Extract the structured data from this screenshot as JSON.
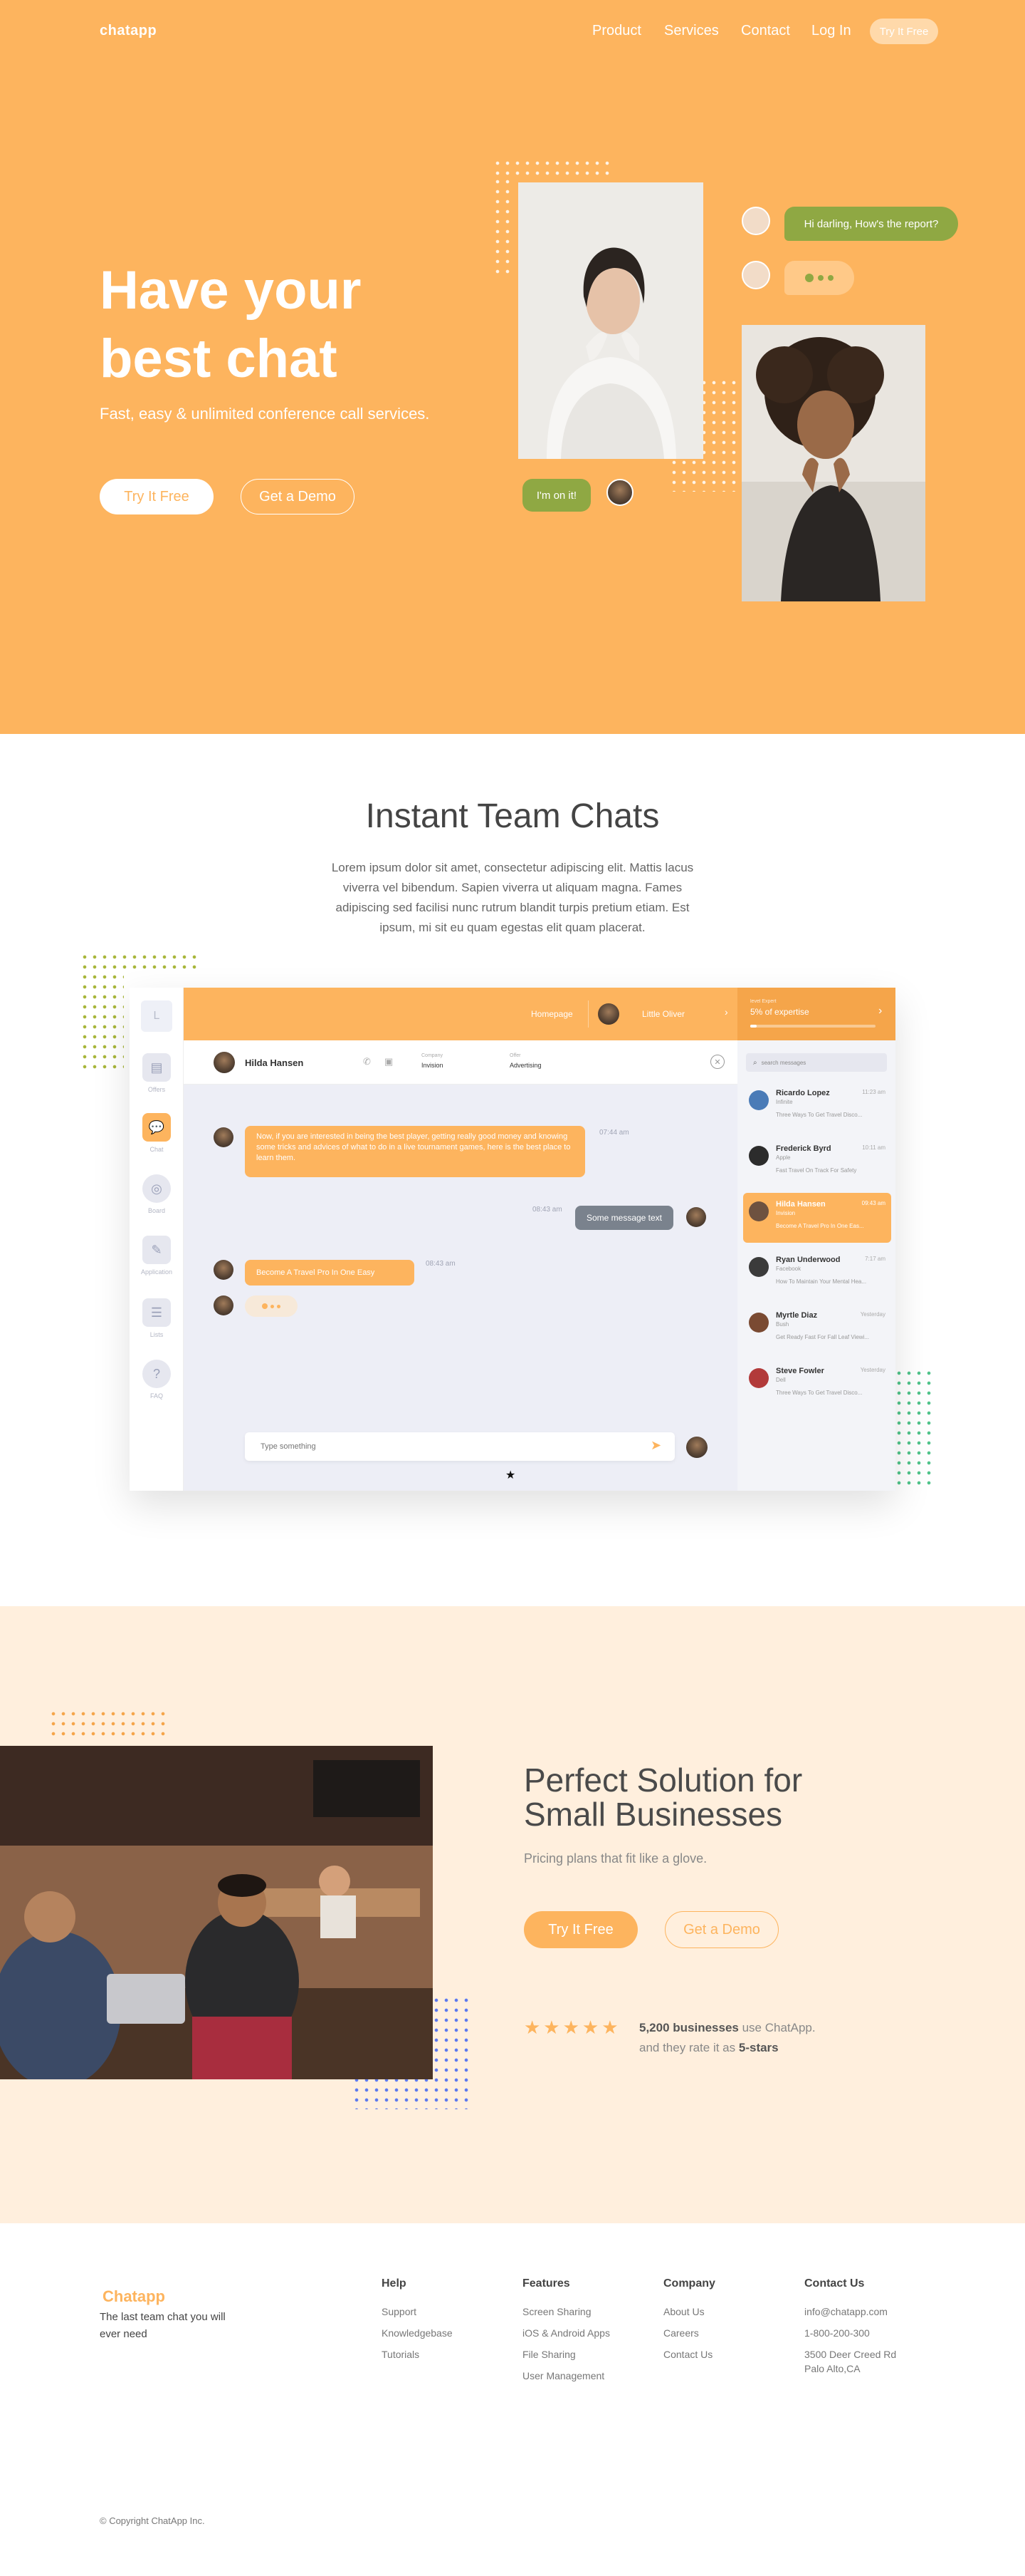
{
  "nav": {
    "logo": "chatapp",
    "links": [
      "Product",
      "Services",
      "Contact",
      "Log In"
    ],
    "cta": "Try It Free"
  },
  "hero": {
    "title_line1": "Have your",
    "title_line2": "best chat",
    "subtitle": "Fast, easy & unlimited conference call services.",
    "primary_button": "Try It Free",
    "secondary_button": "Get a Demo",
    "bubble_1": "Hi darling, How's the report?",
    "bubble_2": "I'm on it!",
    "colors": {
      "bg": "#FDB45E",
      "green": "#8FA843"
    }
  },
  "team": {
    "title": "Instant Team Chats",
    "text": "Lorem ipsum dolor sit amet, consectetur adipiscing elit. Mattis lacus viverra vel bibendum. Sapien viverra ut aliquam magna. Fames adipiscing sed facilisi nunc rutrum blandit turpis pretium etiam. Est ipsum, mi sit eu quam egestas elit quam placerat."
  },
  "app": {
    "sidebar": [
      {
        "label": "Offers",
        "icon": "briefcase-icon"
      },
      {
        "label": "Chat",
        "icon": "chat-icon"
      },
      {
        "label": "Board",
        "icon": "board-icon"
      },
      {
        "label": "Application",
        "icon": "document-icon"
      },
      {
        "label": "Lists",
        "icon": "list-icon"
      },
      {
        "label": "FAQ",
        "icon": "help-icon"
      }
    ],
    "top": {
      "homepage": "Homepage",
      "user": "Little Oliver",
      "expertise_label": "level Expert",
      "expertise": "5% of expertise"
    },
    "chat_header": {
      "name": "Hilda Hansen",
      "company_label": "Company",
      "company": "Invision",
      "offer_label": "Offer",
      "offer": "Advertising"
    },
    "messages": {
      "m1": "Now, if you are interested in being the best player, getting really good money and knowing some tricks and advices of what to do in a live tournament games, here is the best place to learn them.",
      "m1_time": "07:44 am",
      "m2": "Some message text",
      "m2_time": "08:43 am",
      "m3": "Become A Travel Pro In One Easy",
      "m3_time": "08:43 am"
    },
    "input_placeholder": "Type something",
    "search_placeholder": "search messages",
    "contacts": [
      {
        "name": "Ricardo Lopez",
        "sub": "Infinite",
        "msg": "Three Ways To Get Travel Disco...",
        "time": "11:23 am"
      },
      {
        "name": "Frederick Byrd",
        "sub": "Apple",
        "msg": "Fast Travel On Track For Safety",
        "time": "10:11 am"
      },
      {
        "name": "Hilda Hansen",
        "sub": "Invision",
        "msg": "Become A Travel Pro In One Eas...",
        "time": "09:43 am"
      },
      {
        "name": "Ryan Underwood",
        "sub": "Facebook",
        "msg": "How To Maintain Your Mental Hea...",
        "time": "7:17 am"
      },
      {
        "name": "Myrtle Diaz",
        "sub": "Bush",
        "msg": "Get Ready Fast For Fall Leaf Viewi...",
        "time": "Yesterday"
      },
      {
        "name": "Steve Fowler",
        "sub": "Dell",
        "msg": "Three Ways To Get Travel Disco...",
        "time": "Yesterday"
      }
    ]
  },
  "solution": {
    "title_line1": "Perfect Solution for",
    "title_line2": "Small Businesses",
    "subtitle": "Pricing plans that fit like a glove.",
    "primary_button": "Try It Free",
    "secondary_button": "Get a Demo",
    "stars": "★★★★★",
    "rating_count": "5,200 businesses",
    "rating_text_1": " use ChatApp.",
    "rating_text_2": "and they rate it as ",
    "rating_value": "5-stars"
  },
  "footer": {
    "logo": "Chatapp",
    "tagline": "The last team chat you will ever need",
    "columns": [
      {
        "head": "Help",
        "links": [
          "Support",
          "Knowledgebase",
          "Tutorials"
        ]
      },
      {
        "head": "Features",
        "links": [
          "Screen Sharing",
          "iOS & Android Apps",
          "File Sharing",
          "User Management"
        ]
      },
      {
        "head": "Company",
        "links": [
          "About Us",
          "Careers",
          "Contact Us"
        ]
      },
      {
        "head": "Contact Us",
        "links": [
          "info@chatapp.com",
          "1-800-200-300",
          "3500 Deer Creed Rd",
          "Palo Alto,CA"
        ]
      }
    ],
    "copyright": "© Copyright ChatApp Inc."
  }
}
